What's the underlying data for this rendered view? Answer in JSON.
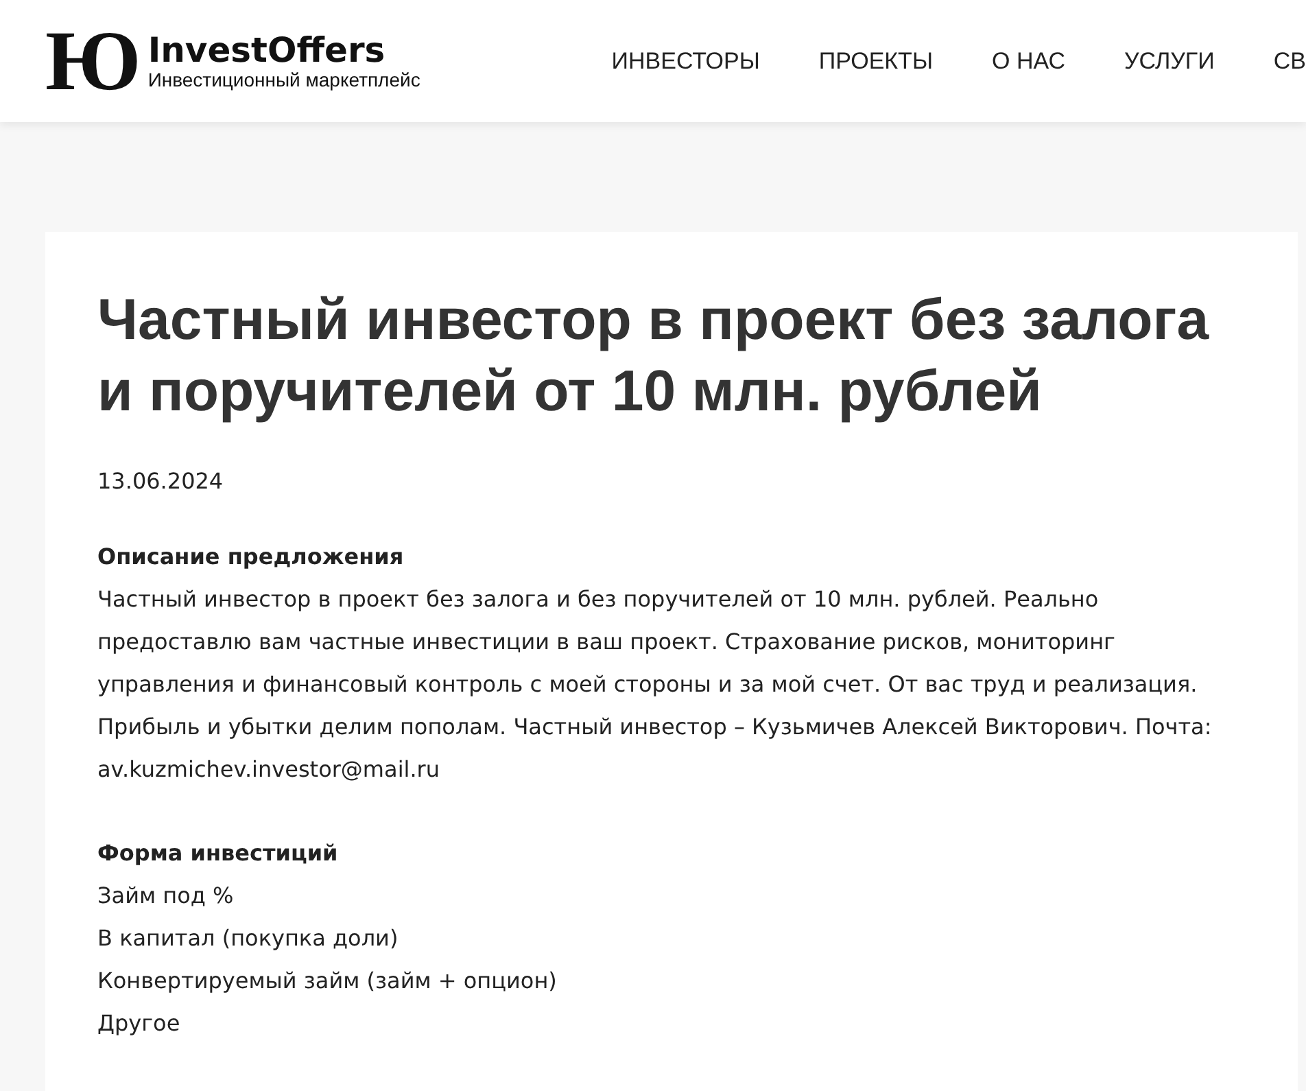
{
  "header": {
    "logo_mark": "Ю",
    "brand": "InvestOffers",
    "tagline": "Инвестиционный маркетплейс",
    "nav": [
      "ИНВЕСТОРЫ",
      "ПРОЕКТЫ",
      "О НАС",
      "УСЛУГИ",
      "СВ"
    ]
  },
  "article": {
    "title": "Частный инвестор в проект без залога и поручителей от 10 млн. рублей",
    "date": "13.06.2024",
    "sections": [
      {
        "heading": "Описание предложения",
        "kind": "paragraph",
        "text": "Частный инвестор в проект без залога и без поручителей от 10 млн. рублей. Реально предоставлю вам частные инвестиции в ваш проект. Страхование рисков, мониторинг управления и финансовый контроль с моей стороны и за мой счет. От вас труд и реализация. Прибыль и убытки делим пополам. Частный инвестор – Кузьмичев Алексей Викторович. Почта: av.kuzmichev.investor@mail.ru"
      },
      {
        "heading": "Форма инвестиций",
        "kind": "list",
        "items": [
          "Займ под %",
          "В капитал (покупка доли)",
          "Конвертируемый займ (займ + опцион)",
          "Другое"
        ]
      }
    ]
  }
}
